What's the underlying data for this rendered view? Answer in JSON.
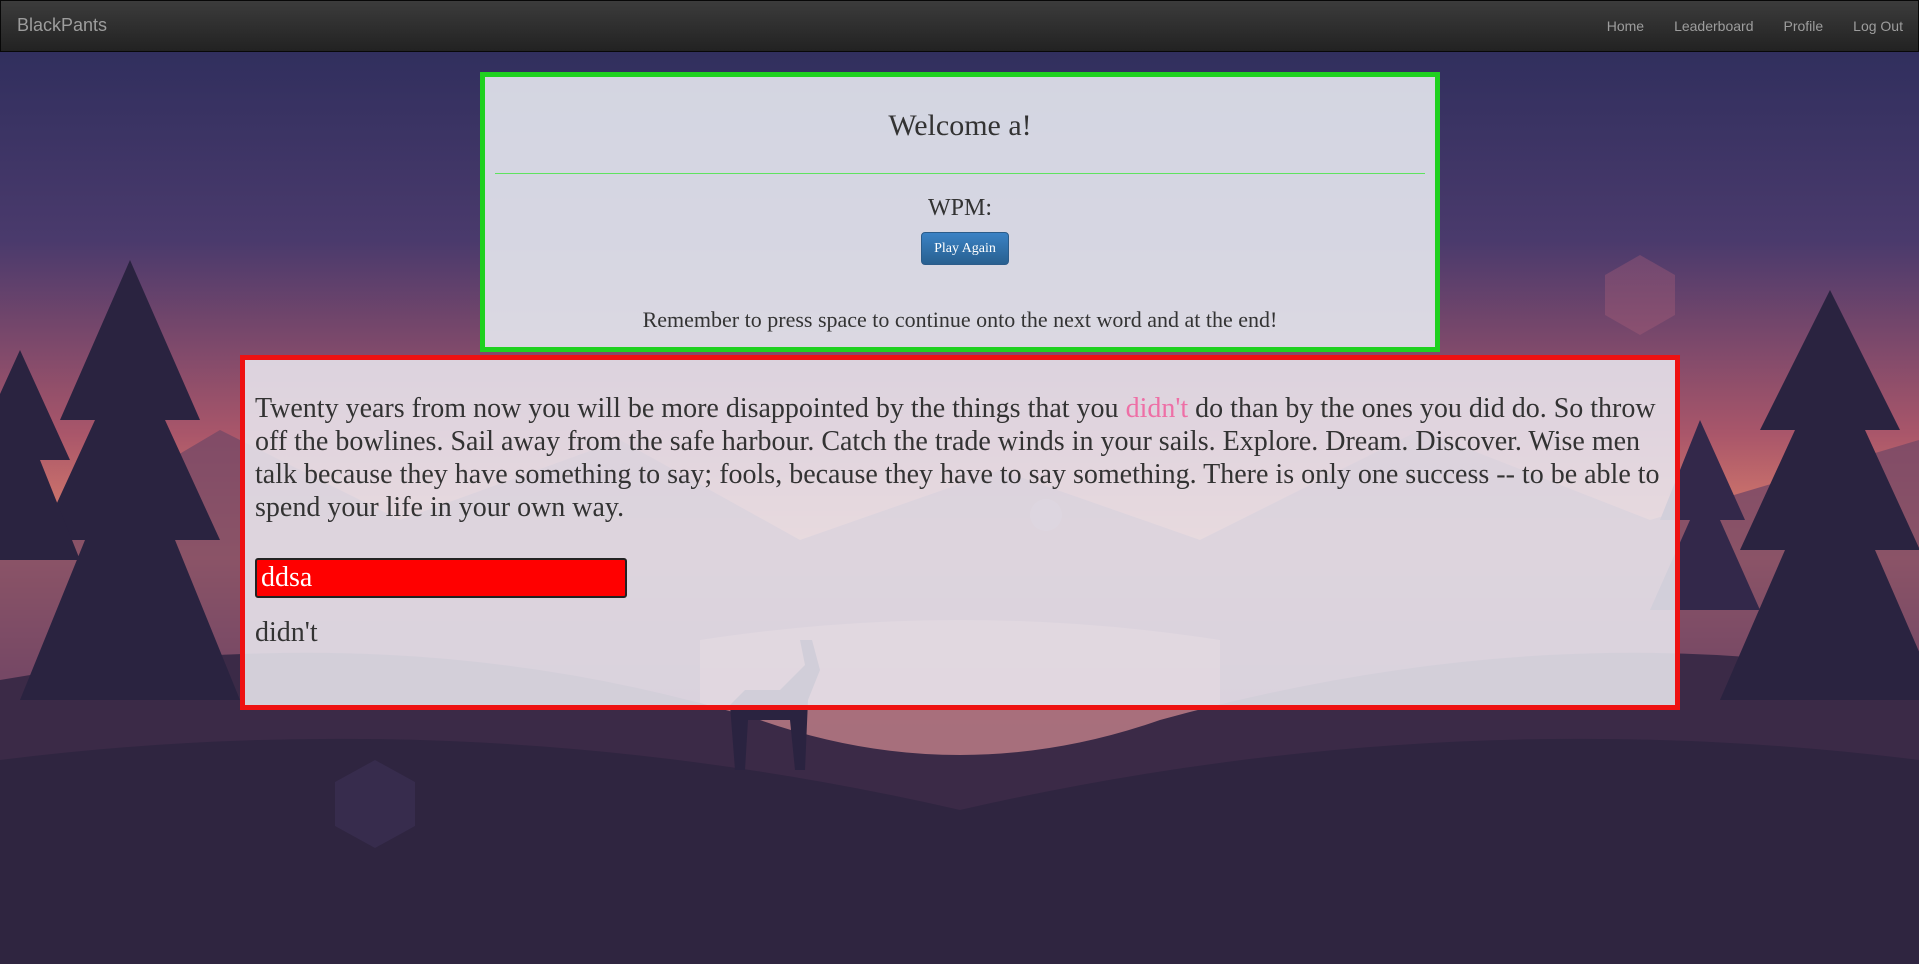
{
  "navbar": {
    "brand": "BlackPants",
    "links": [
      "Home",
      "Leaderboard",
      "Profile",
      "Log Out"
    ]
  },
  "welcome_card": {
    "title": "Welcome a!",
    "wpm_label": "WPM:",
    "play_again_label": "Play Again",
    "reminder": "Remember to press space to continue onto the next word and at the end!"
  },
  "typing_card": {
    "passage_before": "Twenty years from now you will be more disappointed by the things that you ",
    "current_word": "didn't",
    "passage_after": " do than by the ones you did do. So throw off the bowlines. Sail away from the safe harbour. Catch the trade winds in your sails. Explore. Dream. Discover. Wise men talk because they have something to say; fools, because they have to say something. There is only one success -- to be able to spend your life in your own way.",
    "input_value": "ddsa",
    "target_word": "didn't"
  },
  "colors": {
    "top_card_border": "#1fd11f",
    "main_card_border": "#ee1111",
    "current_word": "#ee6fa6",
    "input_error_bg": "#ff0000",
    "button": "#286090"
  }
}
